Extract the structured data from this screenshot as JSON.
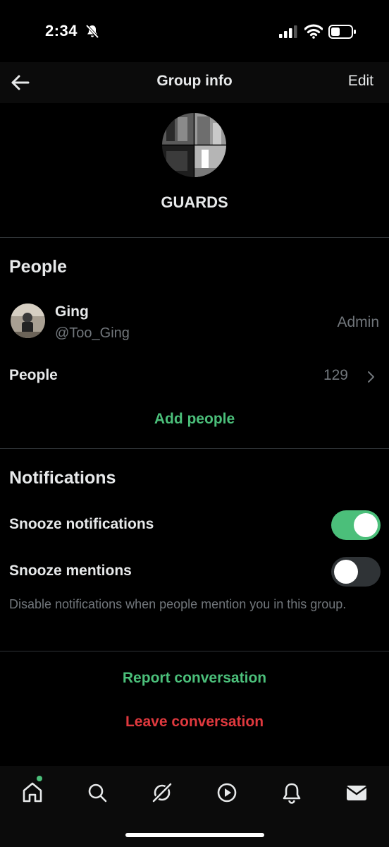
{
  "status_bar": {
    "time": "2:34"
  },
  "header": {
    "title": "Group info",
    "edit_label": "Edit"
  },
  "group": {
    "name": "GUARDS"
  },
  "people_section": {
    "title": "People",
    "member": {
      "name": "Ging",
      "handle": "@Too_Ging",
      "role": "Admin"
    },
    "people_row": {
      "label": "People",
      "count": "129"
    },
    "add_label": "Add people"
  },
  "notifications_section": {
    "title": "Notifications",
    "snooze_notifications": {
      "label": "Snooze notifications",
      "enabled": true
    },
    "snooze_mentions": {
      "label": "Snooze mentions",
      "enabled": false
    },
    "hint": "Disable notifications when people mention you in this group."
  },
  "actions": {
    "report_label": "Report conversation",
    "leave_label": "Leave conversation"
  },
  "tab_bar": {
    "items": [
      "home-icon",
      "search-icon",
      "grok-icon",
      "video-icon",
      "bell-icon",
      "mail-icon"
    ]
  },
  "colors": {
    "accent": "#4bbf7a",
    "danger": "#e0393e",
    "muted": "#71767b",
    "background": "#000000"
  }
}
